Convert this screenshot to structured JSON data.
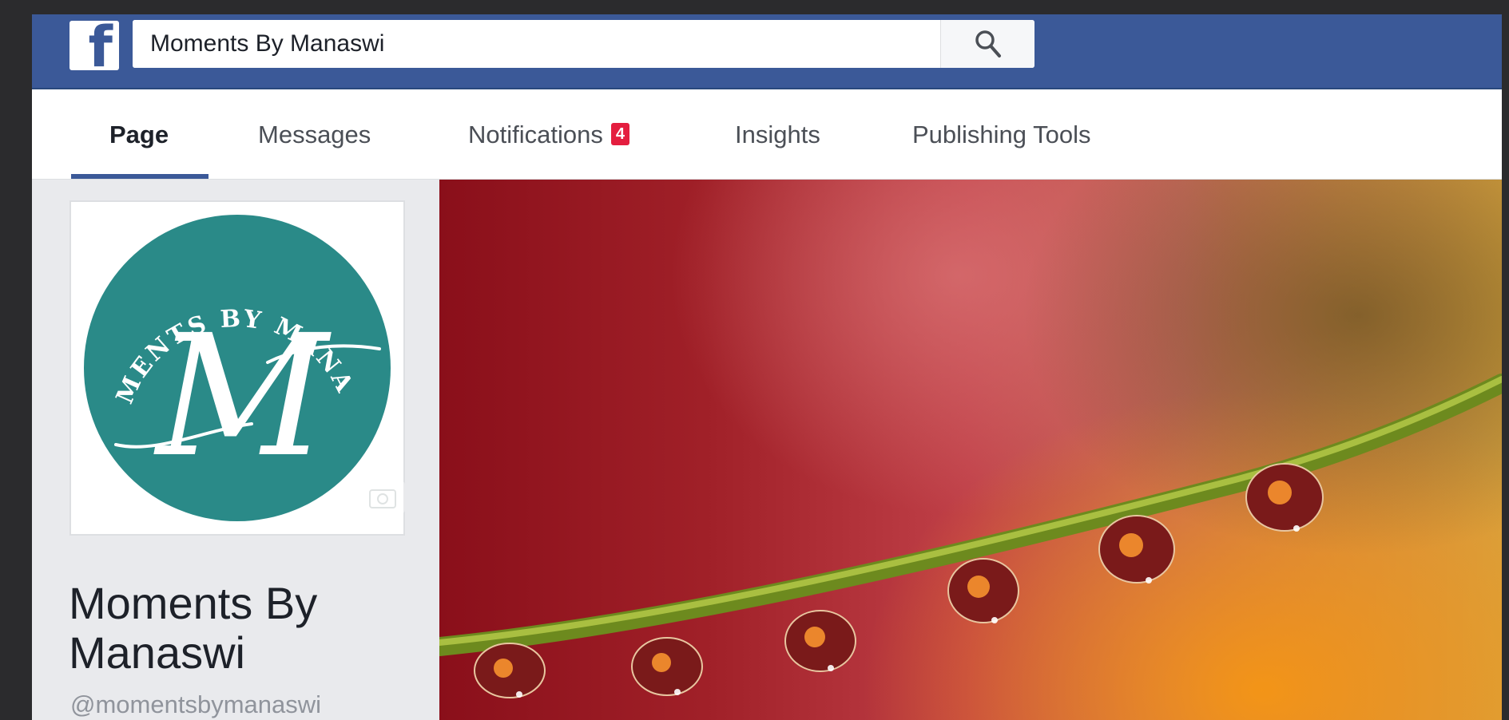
{
  "header": {
    "brand_icon": "facebook-logo-icon",
    "brand_letter": "f",
    "search": {
      "value": "Moments By Manaswi",
      "icon": "search-icon"
    }
  },
  "tabs": [
    {
      "label": "Page",
      "active": true
    },
    {
      "label": "Messages",
      "active": false
    },
    {
      "label": "Notifications",
      "active": false,
      "badge": "4"
    },
    {
      "label": "Insights",
      "active": false
    },
    {
      "label": "Publishing Tools",
      "active": false
    }
  ],
  "profile": {
    "logo_text_arc": "MOMENTS BY MANASWI",
    "logo_letter": "M",
    "logo_color": "#2a8a88",
    "camera_icon": "camera-icon",
    "name": "Moments By Manaswi",
    "handle": "@momentsbymanaswi"
  },
  "colors": {
    "brand": "#3b5998",
    "badge": "#e41e3f"
  }
}
